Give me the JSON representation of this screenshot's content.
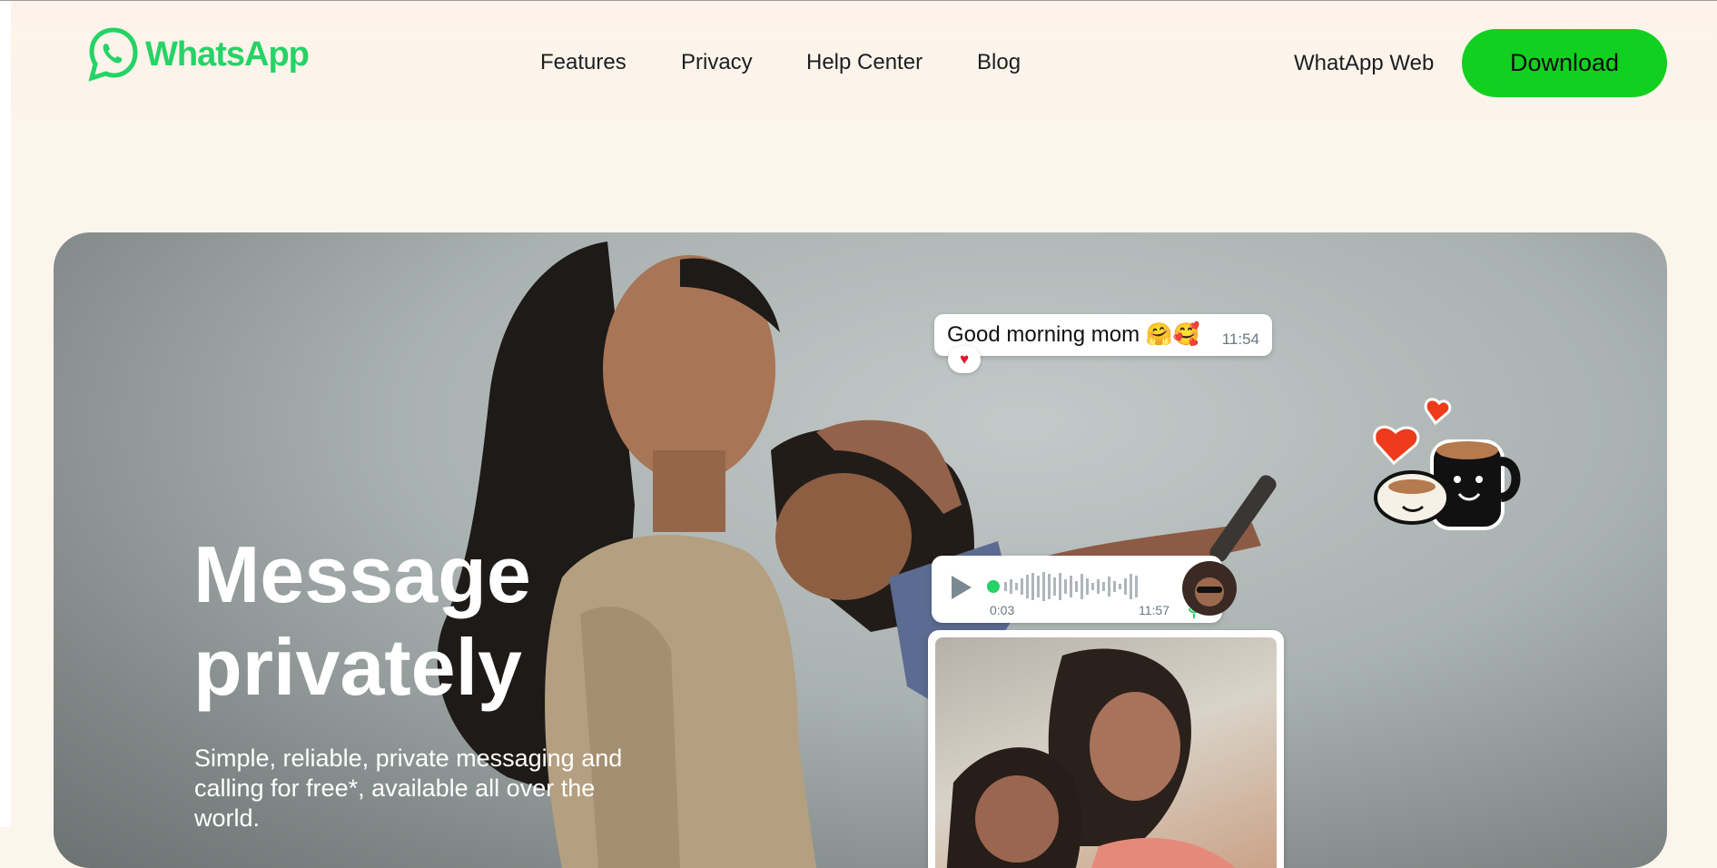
{
  "header": {
    "logo_text": "WhatsApp",
    "nav": [
      {
        "label": "Features"
      },
      {
        "label": "Privacy"
      },
      {
        "label": "Help Center"
      },
      {
        "label": "Blog"
      }
    ],
    "web_link": "WhatApp Web",
    "download_label": "Download"
  },
  "hero": {
    "headline": "Message privately",
    "subtext": "Simple, reliable, private messaging and calling for free*, available all over the world.",
    "chat": {
      "text_bubble": {
        "message": "Good morning mom 🤗🥰",
        "time": "11:54",
        "reaction": "♥"
      },
      "voice_note": {
        "duration": "0:03",
        "time": "11:57"
      }
    }
  },
  "colors": {
    "brand_green": "#25d366",
    "download_bg": "#12d01f",
    "page_bg": "#fcf5eb"
  },
  "icons": [
    "whatsapp-logo-icon",
    "play-icon",
    "mic-icon",
    "heart-icon",
    "coffee-sticker-icon"
  ]
}
